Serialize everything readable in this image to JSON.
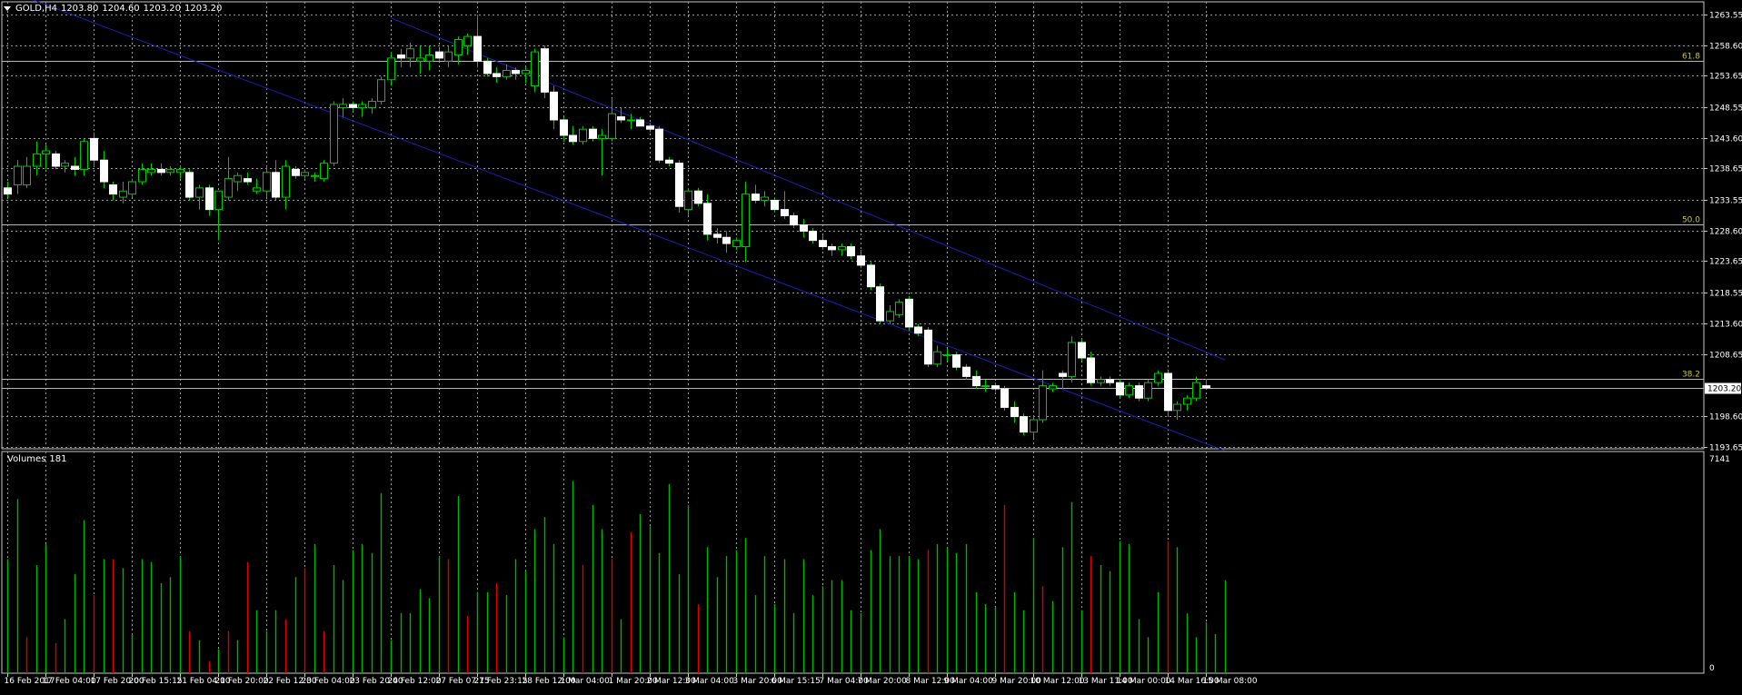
{
  "header": {
    "symbol": "GOLD,H4",
    "open": "1203.80",
    "high": "1204.60",
    "low": "1203.20",
    "close": "1203.20"
  },
  "volume_panel": {
    "title": "Volumes",
    "value": "181"
  },
  "colors": {
    "background": "#000000",
    "grid": "#9a9a9a",
    "candle_bull_body": "#000000",
    "candle_bear_body": "#ffffff",
    "candle_outline": "#ffffff",
    "wick": "#00c800",
    "volume_up": "#00b400",
    "volume_down": "#e00000",
    "channel": "#1e1eb4",
    "fib": "#c8c832",
    "price_line": "#b4b4b4"
  },
  "chart_data": [
    {
      "type": "candlestick",
      "title": "GOLD,H4",
      "x_ticks": [
        "16 Feb 2017",
        "17 Feb 04:00",
        "17 Feb 20:00",
        "20 Feb 15:15",
        "21 Feb 04:00",
        "21 Feb 20:00",
        "22 Feb 12:00",
        "23 Feb 04:00",
        "23 Feb 20:00",
        "24 Feb 12:00",
        "27 Feb 07:15",
        "27 Feb 23:15",
        "28 Feb 12:00",
        "1 Mar 04:00",
        "1 Mar 20:00",
        "2 Mar 12:00",
        "3 Mar 04:00",
        "3 Mar 20:00",
        "6 Mar 15:15",
        "7 Mar 04:00",
        "7 Mar 20:00",
        "8 Mar 12:00",
        "9 Mar 04:00",
        "9 Mar 20:00",
        "10 Mar 12:00",
        "13 Mar 11:00",
        "14 Mar 00:00",
        "14 Mar 16:00",
        "15 Mar 08:00"
      ],
      "y_ticks": [
        "1263.55",
        "1258.60",
        "1253.65",
        "1248.55",
        "1243.60",
        "1238.65",
        "1233.55",
        "1228.60",
        "1223.65",
        "1218.55",
        "1213.60",
        "1208.65",
        "1198.60",
        "1193.65"
      ],
      "ylim": [
        1193.3,
        1265.6
      ],
      "current_price": "1203.20",
      "fib_levels": [
        {
          "label": "61.8",
          "price": 1256.1
        },
        {
          "label": "50.0",
          "price": 1229.6
        },
        {
          "label": "38.2",
          "price": 1204.6
        }
      ],
      "channel": {
        "upper": [
          [
            0,
            1267.5
          ],
          [
            127,
            1193.0
          ]
        ],
        "lower": [
          [
            40,
            1263.0
          ],
          [
            127,
            1207.7
          ]
        ]
      },
      "ohlc": [
        [
          1235.5,
          1236.5,
          1234.0,
          1234.5
        ],
        [
          1236.0,
          1240.0,
          1234.5,
          1239.0
        ],
        [
          1236.0,
          1240.5,
          1235.5,
          1239.0
        ],
        [
          1239.0,
          1243.0,
          1237.5,
          1241.0
        ],
        [
          1241.0,
          1242.5,
          1238.5,
          1241.5
        ],
        [
          1241.0,
          1241.5,
          1238.5,
          1239.0
        ],
        [
          1239.0,
          1240.0,
          1238.0,
          1239.5
        ],
        [
          1239.0,
          1240.5,
          1237.5,
          1238.5
        ],
        [
          1238.5,
          1243.5,
          1237.5,
          1243.0
        ],
        [
          1243.5,
          1244.5,
          1239.0,
          1240.0
        ],
        [
          1240.0,
          1241.5,
          1235.5,
          1236.5
        ],
        [
          1236.0,
          1236.5,
          1233.5,
          1234.5
        ],
        [
          1234.0,
          1236.5,
          1233.0,
          1235.0
        ],
        [
          1234.5,
          1237.0,
          1234.0,
          1236.5
        ],
        [
          1236.5,
          1239.5,
          1236.0,
          1238.5
        ],
        [
          1238.0,
          1239.5,
          1237.5,
          1238.5
        ],
        [
          1238.5,
          1239.5,
          1237.5,
          1238.0
        ],
        [
          1238.0,
          1239.0,
          1237.5,
          1238.5
        ],
        [
          1238.0,
          1239.0,
          1237.0,
          1238.5
        ],
        [
          1238.0,
          1238.5,
          1233.5,
          1234.0
        ],
        [
          1234.0,
          1236.0,
          1232.0,
          1235.5
        ],
        [
          1235.5,
          1236.0,
          1231.0,
          1232.0
        ],
        [
          1232.0,
          1234.5,
          1227.0,
          1235.0
        ],
        [
          1234.0,
          1240.5,
          1233.5,
          1237.0
        ],
        [
          1236.5,
          1238.0,
          1235.0,
          1237.5
        ],
        [
          1237.0,
          1238.0,
          1236.0,
          1236.5
        ],
        [
          1235.0,
          1237.0,
          1234.5,
          1235.5
        ],
        [
          1235.0,
          1239.0,
          1234.0,
          1238.0
        ],
        [
          1238.0,
          1240.0,
          1233.5,
          1234.0
        ],
        [
          1234.0,
          1240.0,
          1232.0,
          1239.0
        ],
        [
          1238.5,
          1239.0,
          1237.0,
          1237.5
        ],
        [
          1237.5,
          1238.5,
          1237.0,
          1238.0
        ],
        [
          1237.5,
          1238.0,
          1236.5,
          1237.5
        ],
        [
          1237.0,
          1240.0,
          1236.5,
          1239.5
        ],
        [
          1239.5,
          1249.5,
          1239.0,
          1249.0
        ],
        [
          1248.5,
          1250.0,
          1247.0,
          1249.0
        ],
        [
          1249.0,
          1249.5,
          1248.0,
          1248.5
        ],
        [
          1248.5,
          1249.5,
          1247.0,
          1249.0
        ],
        [
          1248.5,
          1250.0,
          1247.5,
          1249.5
        ],
        [
          1249.5,
          1253.5,
          1249.0,
          1253.0
        ],
        [
          1253.0,
          1257.5,
          1252.0,
          1256.5
        ],
        [
          1257.0,
          1258.0,
          1255.0,
          1256.5
        ],
        [
          1256.5,
          1259.0,
          1255.0,
          1258.0
        ],
        [
          1256.0,
          1258.5,
          1254.0,
          1256.5
        ],
        [
          1256.0,
          1258.5,
          1254.5,
          1257.0
        ],
        [
          1257.5,
          1258.0,
          1256.0,
          1256.5
        ],
        [
          1256.0,
          1258.5,
          1255.0,
          1257.5
        ],
        [
          1257.0,
          1260.0,
          1255.5,
          1259.5
        ],
        [
          1258.5,
          1260.5,
          1257.0,
          1260.0
        ],
        [
          1260.0,
          1263.5,
          1255.0,
          1256.0
        ],
        [
          1256.0,
          1256.5,
          1253.5,
          1254.0
        ],
        [
          1254.0,
          1255.0,
          1252.5,
          1253.5
        ],
        [
          1253.5,
          1255.5,
          1253.0,
          1254.5
        ],
        [
          1254.5,
          1255.0,
          1253.0,
          1254.0
        ],
        [
          1254.0,
          1255.0,
          1252.5,
          1254.5
        ],
        [
          1252.0,
          1258.0,
          1251.0,
          1257.5
        ],
        [
          1258.0,
          1258.5,
          1250.0,
          1251.0
        ],
        [
          1251.0,
          1252.0,
          1245.0,
          1246.5
        ],
        [
          1246.5,
          1247.0,
          1243.0,
          1244.0
        ],
        [
          1244.0,
          1245.5,
          1242.5,
          1243.0
        ],
        [
          1243.0,
          1245.5,
          1242.5,
          1245.0
        ],
        [
          1245.0,
          1245.5,
          1243.0,
          1243.5
        ],
        [
          1243.5,
          1245.0,
          1237.5,
          1244.0
        ],
        [
          1243.5,
          1250.0,
          1243.0,
          1247.5
        ],
        [
          1247.0,
          1248.5,
          1246.0,
          1246.5
        ],
        [
          1246.5,
          1247.5,
          1245.0,
          1246.5
        ],
        [
          1246.5,
          1247.0,
          1245.5,
          1245.5
        ],
        [
          1245.5,
          1246.0,
          1244.5,
          1245.0
        ],
        [
          1245.0,
          1245.5,
          1239.5,
          1240.0
        ],
        [
          1240.0,
          1240.5,
          1239.0,
          1239.5
        ],
        [
          1239.5,
          1240.0,
          1231.5,
          1232.5
        ],
        [
          1232.0,
          1235.5,
          1231.0,
          1235.0
        ],
        [
          1235.0,
          1235.5,
          1232.5,
          1233.0
        ],
        [
          1233.0,
          1234.5,
          1227.0,
          1228.0
        ],
        [
          1228.0,
          1229.0,
          1226.5,
          1227.5
        ],
        [
          1227.5,
          1228.5,
          1225.0,
          1226.5
        ],
        [
          1226.0,
          1227.5,
          1225.5,
          1227.0
        ],
        [
          1226.0,
          1236.5,
          1223.5,
          1234.5
        ],
        [
          1234.5,
          1236.0,
          1233.0,
          1233.5
        ],
        [
          1233.5,
          1235.0,
          1232.5,
          1234.0
        ],
        [
          1233.5,
          1234.0,
          1231.5,
          1232.0
        ],
        [
          1232.0,
          1235.0,
          1230.5,
          1231.0
        ],
        [
          1231.0,
          1231.5,
          1229.0,
          1229.5
        ],
        [
          1229.5,
          1230.5,
          1227.5,
          1228.5
        ],
        [
          1228.5,
          1229.0,
          1226.5,
          1227.0
        ],
        [
          1227.0,
          1228.0,
          1225.5,
          1226.0
        ],
        [
          1226.0,
          1226.5,
          1224.5,
          1225.5
        ],
        [
          1225.5,
          1226.5,
          1224.5,
          1226.0
        ],
        [
          1226.0,
          1226.5,
          1224.0,
          1224.5
        ],
        [
          1224.5,
          1225.5,
          1222.5,
          1223.0
        ],
        [
          1223.0,
          1223.5,
          1219.0,
          1219.5
        ],
        [
          1219.5,
          1220.0,
          1213.5,
          1214.0
        ],
        [
          1214.0,
          1216.5,
          1213.5,
          1215.5
        ],
        [
          1215.0,
          1217.5,
          1214.5,
          1217.0
        ],
        [
          1217.5,
          1218.0,
          1212.5,
          1213.0
        ],
        [
          1213.0,
          1213.5,
          1211.5,
          1212.0
        ],
        [
          1212.5,
          1213.0,
          1206.5,
          1207.0
        ],
        [
          1207.0,
          1210.0,
          1206.5,
          1209.0
        ],
        [
          1208.5,
          1209.5,
          1207.5,
          1208.5
        ],
        [
          1208.5,
          1209.0,
          1206.0,
          1206.5
        ],
        [
          1206.5,
          1207.0,
          1204.5,
          1205.0
        ],
        [
          1205.0,
          1206.0,
          1203.0,
          1203.5
        ],
        [
          1203.5,
          1204.5,
          1202.5,
          1203.5
        ],
        [
          1203.5,
          1204.0,
          1202.5,
          1203.0
        ],
        [
          1203.0,
          1203.5,
          1199.5,
          1200.0
        ],
        [
          1200.0,
          1201.0,
          1197.5,
          1198.5
        ],
        [
          1198.5,
          1199.0,
          1195.5,
          1196.0
        ],
        [
          1196.0,
          1198.5,
          1195.0,
          1198.0
        ],
        [
          1198.0,
          1206.0,
          1197.5,
          1203.5
        ],
        [
          1203.0,
          1204.0,
          1202.5,
          1203.5
        ],
        [
          1205.5,
          1206.0,
          1203.0,
          1205.0
        ],
        [
          1205.0,
          1211.5,
          1204.0,
          1210.5
        ],
        [
          1210.5,
          1211.0,
          1207.5,
          1208.0
        ],
        [
          1208.0,
          1209.0,
          1203.5,
          1204.0
        ],
        [
          1204.0,
          1205.0,
          1203.5,
          1204.5
        ],
        [
          1204.5,
          1205.0,
          1203.5,
          1204.0
        ],
        [
          1204.0,
          1204.5,
          1201.5,
          1202.0
        ],
        [
          1202.0,
          1204.0,
          1201.5,
          1203.5
        ],
        [
          1203.5,
          1204.0,
          1201.0,
          1201.5
        ],
        [
          1201.5,
          1204.5,
          1201.0,
          1204.0
        ],
        [
          1204.0,
          1206.0,
          1203.5,
          1205.5
        ],
        [
          1205.5,
          1206.0,
          1198.5,
          1199.5
        ],
        [
          1199.5,
          1201.0,
          1198.0,
          1200.5
        ],
        [
          1200.5,
          1202.0,
          1199.5,
          1201.5
        ],
        [
          1201.5,
          1205.0,
          1201.0,
          1204.0
        ],
        [
          1203.5,
          1204.6,
          1203.2,
          1203.2
        ]
      ]
    },
    {
      "type": "bar",
      "title": "Volumes 181",
      "y_ticks": [
        "7141",
        "0"
      ],
      "ylim": [
        0,
        7141
      ],
      "values": [
        3800,
        5800,
        1200,
        3600,
        4300,
        1000,
        1800,
        3300,
        5100,
        2600,
        3800,
        3800,
        3500,
        1300,
        3800,
        3700,
        3000,
        3200,
        3900,
        1400,
        1100,
        400,
        800,
        1400,
        1100,
        3700,
        2100,
        1400,
        2100,
        1800,
        3200,
        3500,
        4300,
        1400,
        3600,
        3100,
        4100,
        4300,
        4000,
        6000,
        1100,
        2000,
        2000,
        2800,
        2500,
        3900,
        3800,
        5900,
        1900,
        2700,
        2700,
        3000,
        2600,
        3800,
        3400,
        4800,
        5200,
        4300,
        1200,
        6400,
        3600,
        5600,
        4800,
        3800,
        1800,
        4700,
        5300,
        4900,
        4000,
        6300,
        3300,
        5600,
        2300,
        4200,
        3200,
        3900,
        4100,
        4500,
        2600,
        3900,
        2300,
        3800,
        2000,
        3800,
        2600,
        2900,
        3100,
        3100,
        2100,
        2000,
        4100,
        4800,
        3900,
        3900,
        3900,
        3800,
        4100,
        4300,
        4200,
        4000,
        4300,
        2700,
        2300,
        2200,
        5600,
        2700,
        2100,
        4500,
        2900,
        2400,
        4200,
        5700,
        2100,
        3900,
        3600,
        3400,
        4400,
        4300,
        1800,
        1200,
        2700,
        4400,
        4200,
        2000,
        1200,
        1700,
        1300,
        3100
      ],
      "bar_colors": [
        "up",
        "up",
        "down",
        "up",
        "up",
        "down",
        "up",
        "up",
        "up",
        "down",
        "up",
        "down",
        "up",
        "up",
        "up",
        "up",
        "up",
        "up",
        "up",
        "down",
        "up",
        "down",
        "up",
        "down",
        "up",
        "down",
        "up",
        "up",
        "up",
        "down",
        "up",
        "down",
        "up",
        "down",
        "up",
        "up",
        "up",
        "up",
        "up",
        "up",
        "up",
        "up",
        "up",
        "up",
        "up",
        "up",
        "down",
        "up",
        "down",
        "up",
        "up",
        "down",
        "up",
        "up",
        "up",
        "up",
        "up",
        "up",
        "up",
        "up",
        "down",
        "up",
        "up",
        "down",
        "up",
        "down",
        "up",
        "up",
        "up",
        "up",
        "up",
        "up",
        "down",
        "up",
        "up",
        "up",
        "up",
        "up",
        "up",
        "up",
        "up",
        "up",
        "up",
        "up",
        "up",
        "up",
        "up",
        "up",
        "up",
        "up",
        "up",
        "up",
        "up",
        "up",
        "up",
        "up",
        "down",
        "up",
        "up",
        "up",
        "up",
        "up",
        "up",
        "up",
        "down",
        "up",
        "up",
        "up",
        "down",
        "up",
        "up",
        "up",
        "up",
        "down",
        "up",
        "up",
        "up",
        "up",
        "up",
        "up",
        "up",
        "down",
        "up",
        "up",
        "up",
        "up",
        "up",
        "up"
      ]
    }
  ]
}
